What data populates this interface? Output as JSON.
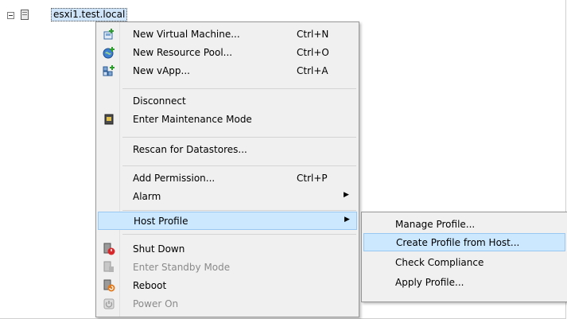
{
  "tree": {
    "host_label": "esxi1.test.local"
  },
  "menu": {
    "new_vm": {
      "label": "New Virtual Machine...",
      "shortcut": "Ctrl+N"
    },
    "new_pool": {
      "label": "New Resource Pool...",
      "shortcut": "Ctrl+O"
    },
    "new_vapp": {
      "label": "New vApp...",
      "shortcut": "Ctrl+A"
    },
    "disconnect": {
      "label": "Disconnect"
    },
    "maintenance": {
      "label": "Enter Maintenance Mode"
    },
    "rescan": {
      "label": "Rescan for Datastores..."
    },
    "add_permission": {
      "label": "Add Permission...",
      "shortcut": "Ctrl+P"
    },
    "alarm": {
      "label": "Alarm",
      "arrow": "▶"
    },
    "host_profile": {
      "label": "Host Profile",
      "arrow": "▶"
    },
    "shutdown": {
      "label": "Shut Down"
    },
    "standby": {
      "label": "Enter Standby Mode"
    },
    "reboot": {
      "label": "Reboot"
    },
    "power_on": {
      "label": "Power On"
    }
  },
  "submenu": {
    "manage": "Manage Profile...",
    "create": "Create Profile from Host...",
    "compliance": "Check Compliance",
    "apply": "Apply Profile..."
  },
  "colors": {
    "highlight": "#cce8ff",
    "menu_bg": "#f0f0f0"
  }
}
